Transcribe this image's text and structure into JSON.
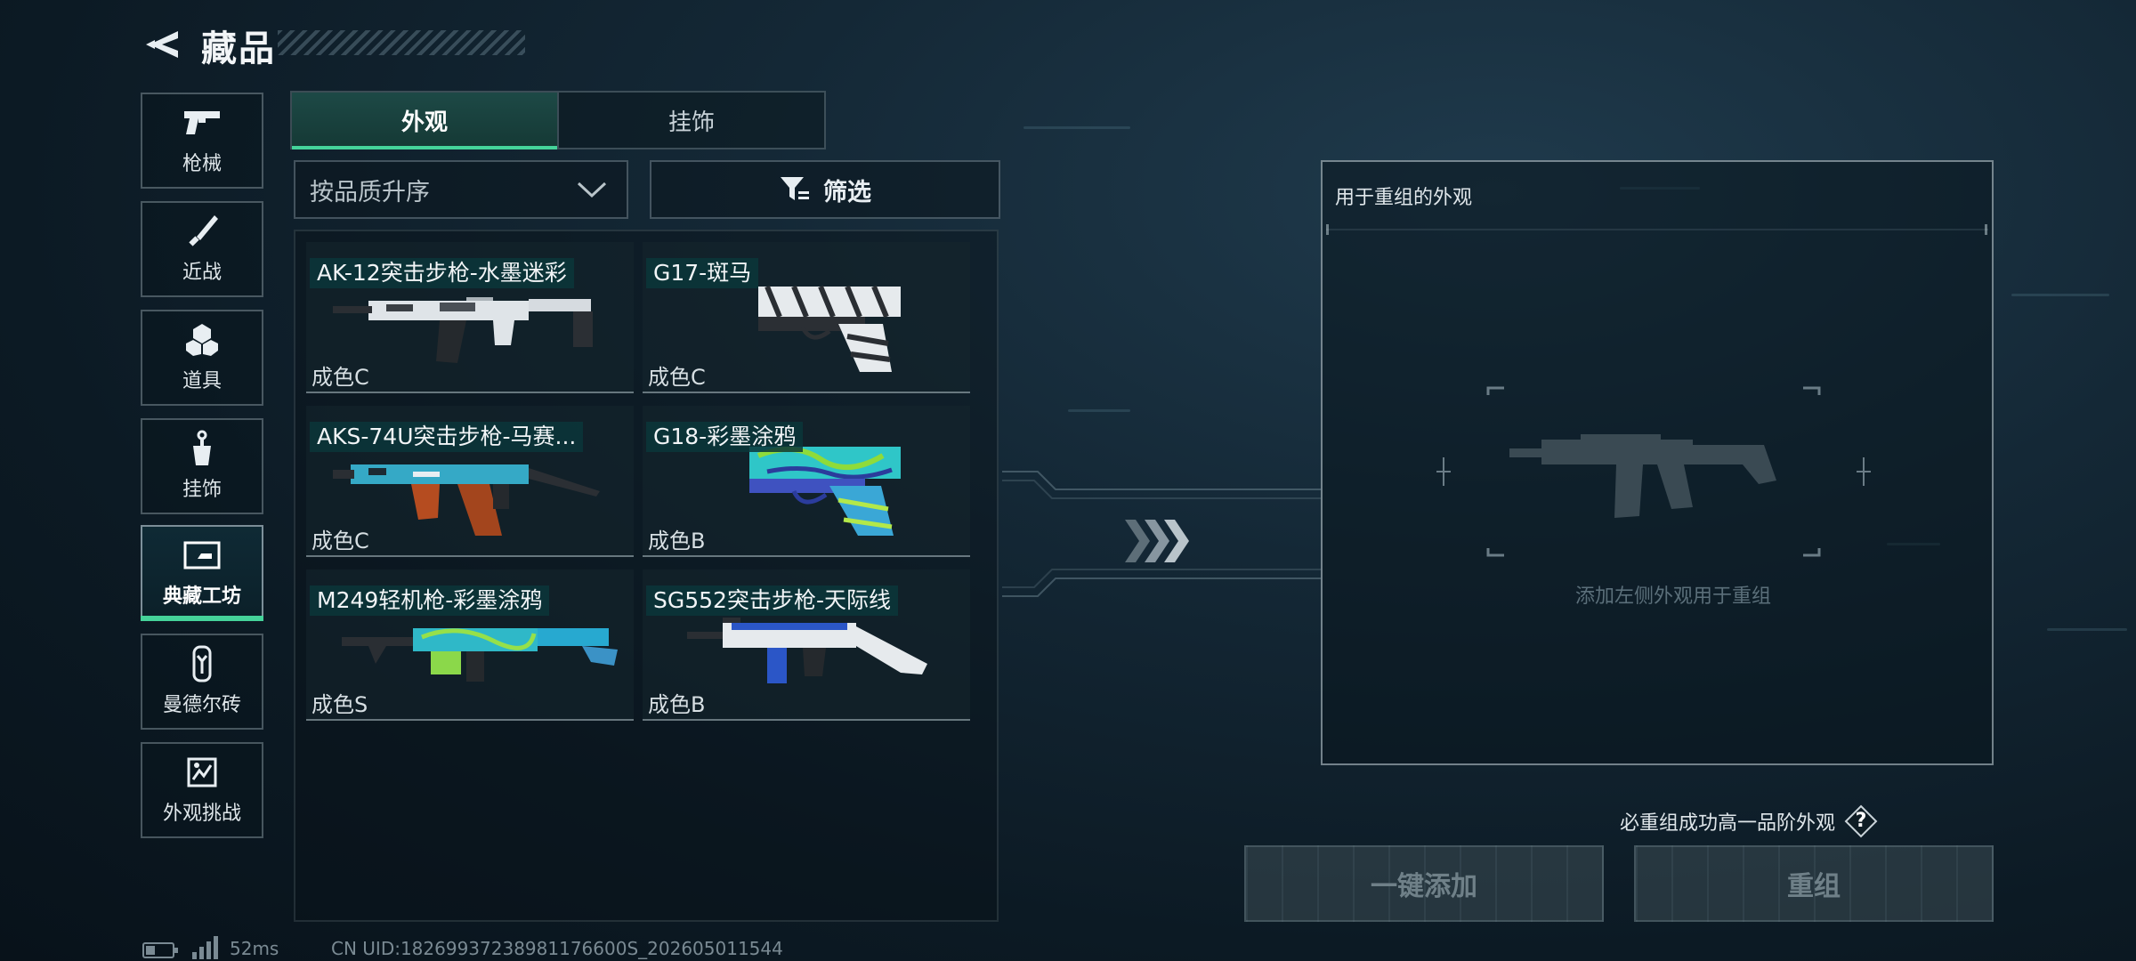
{
  "header": {
    "title": "藏品"
  },
  "sidebar": {
    "items": [
      {
        "label": "枪械",
        "icon": "pistol-icon"
      },
      {
        "label": "近战",
        "icon": "knife-icon"
      },
      {
        "label": "道具",
        "icon": "grenade-icon"
      },
      {
        "label": "挂饰",
        "icon": "charm-icon"
      },
      {
        "label": "典藏工坊",
        "icon": "workshop-icon",
        "active": true
      },
      {
        "label": "曼德尔砖",
        "icon": "brick-icon"
      },
      {
        "label": "外观挑战",
        "icon": "challenge-icon"
      }
    ]
  },
  "tabs": [
    {
      "label": "外观",
      "active": true
    },
    {
      "label": "挂饰",
      "active": false
    }
  ],
  "sort": {
    "label": "按品质升序"
  },
  "filter": {
    "label": "筛选"
  },
  "skins": [
    {
      "name": "AK-12突击步枪-水墨迷彩",
      "grade": "成色C"
    },
    {
      "name": "G17-斑马",
      "grade": "成色C"
    },
    {
      "name": "AKS-74U突击步枪-马赛...",
      "grade": "成色C"
    },
    {
      "name": "G18-彩墨涂鸦",
      "grade": "成色B"
    },
    {
      "name": "M249轻机枪-彩墨涂鸦",
      "grade": "成色S"
    },
    {
      "name": "SG552突击步枪-天际线",
      "grade": "成色B"
    }
  ],
  "recombine": {
    "title": "用于重组的外观",
    "hint": "添加左侧外观用于重组",
    "guarantee": "必重组成功高一品阶外观",
    "help_label": "?"
  },
  "actions": {
    "auto_add": "一键添加",
    "recombine": "重组"
  },
  "status": {
    "ping": "52ms",
    "uid": "CN UID:18269937238981176600S_202605011544"
  },
  "colors": {
    "accent": "#45d39a",
    "background": "#0c1a24"
  }
}
